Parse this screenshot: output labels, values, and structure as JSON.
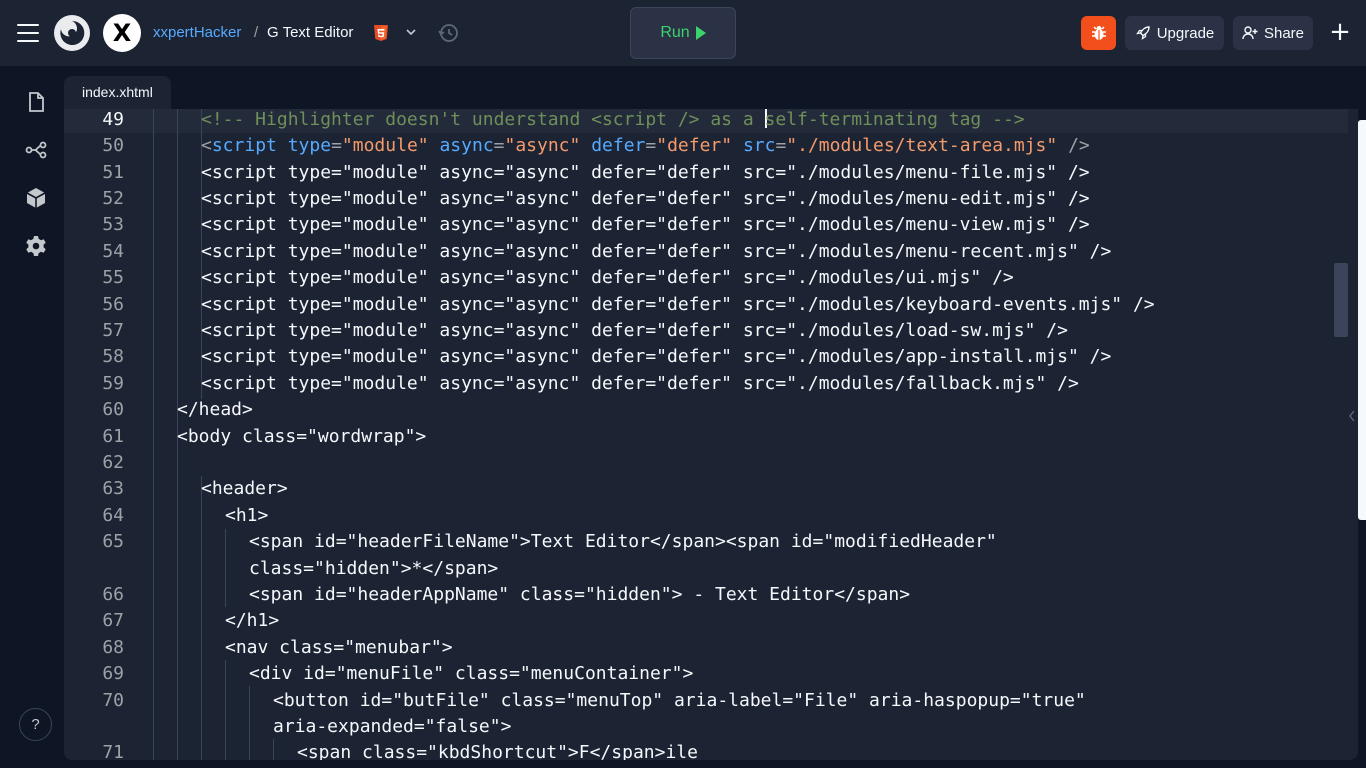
{
  "header": {
    "username": "xxpertHacker",
    "separator": "/",
    "repl_name": "G Text Editor",
    "avatar_letter": "X",
    "run_label": "Run",
    "upgrade_label": "Upgrade",
    "share_label": "Share",
    "add_label": "+"
  },
  "sidebar": {
    "items": [
      {
        "icon": "file-icon"
      },
      {
        "icon": "git-branch-icon"
      },
      {
        "icon": "package-icon"
      },
      {
        "icon": "gear-icon"
      }
    ],
    "help_label": "?"
  },
  "editor": {
    "tab_label": "index.xhtml",
    "active_line": "49",
    "line_numbers": [
      "49",
      "50",
      "51",
      "52",
      "53",
      "54",
      "55",
      "56",
      "57",
      "58",
      "59",
      "60",
      "61",
      "62",
      "63",
      "64",
      "65",
      "",
      "66",
      "67",
      "68",
      "69",
      "70",
      "",
      "71"
    ],
    "plain_lines": [
      "<script type=\"module\" async=\"async\" defer=\"defer\" src=\"./modules/menu-file.mjs\" />",
      "<script type=\"module\" async=\"async\" defer=\"defer\" src=\"./modules/menu-edit.mjs\" />",
      "<script type=\"module\" async=\"async\" defer=\"defer\" src=\"./modules/menu-view.mjs\" />",
      "<script type=\"module\" async=\"async\" defer=\"defer\" src=\"./modules/menu-recent.mjs\" />",
      "<script type=\"module\" async=\"async\" defer=\"defer\" src=\"./modules/ui.mjs\" />",
      "<script type=\"module\" async=\"async\" defer=\"defer\" src=\"./modules/keyboard-events.mjs\" />",
      "<script type=\"module\" async=\"async\" defer=\"defer\" src=\"./modules/load-sw.mjs\" />",
      "<script type=\"module\" async=\"async\" defer=\"defer\" src=\"./modules/app-install.mjs\" />",
      "<script type=\"module\" async=\"async\" defer=\"defer\" src=\"./modules/fallback.mjs\" />",
      "</head>",
      "<body class=\"wordwrap\">",
      "",
      "<header>",
      "<h1>",
      "<span id=\"headerFileName\">Text Editor</span><span id=\"modifiedHeader\"",
      "class=\"hidden\">*</span>",
      "<span id=\"headerAppName\" class=\"hidden\"> - Text Editor</span>",
      "</h1>",
      "<nav class=\"menubar\">",
      "<div id=\"menuFile\" class=\"menuContainer\">",
      "<button id=\"butFile\" class=\"menuTop\" aria-label=\"File\" aria-haspopup=\"true\"",
      "aria-expanded=\"false\">",
      "<span class=\"kbdShortcut\">F</span>ile"
    ],
    "comment_before_cursor": "<!-- Highlighter doesn't understand <script /> as a ",
    "comment_after_cursor": "self-terminating tag -->",
    "line50": {
      "open": "<",
      "tag": "script",
      "a1": "type",
      "v1": "\"module\"",
      "a2": "async",
      "v2": "\"async\"",
      "a3": "defer",
      "v3": "\"defer\"",
      "a4": "src",
      "v4": "\"./modules/text-area.mjs\"",
      "close": "/>",
      "eq": "="
    }
  }
}
